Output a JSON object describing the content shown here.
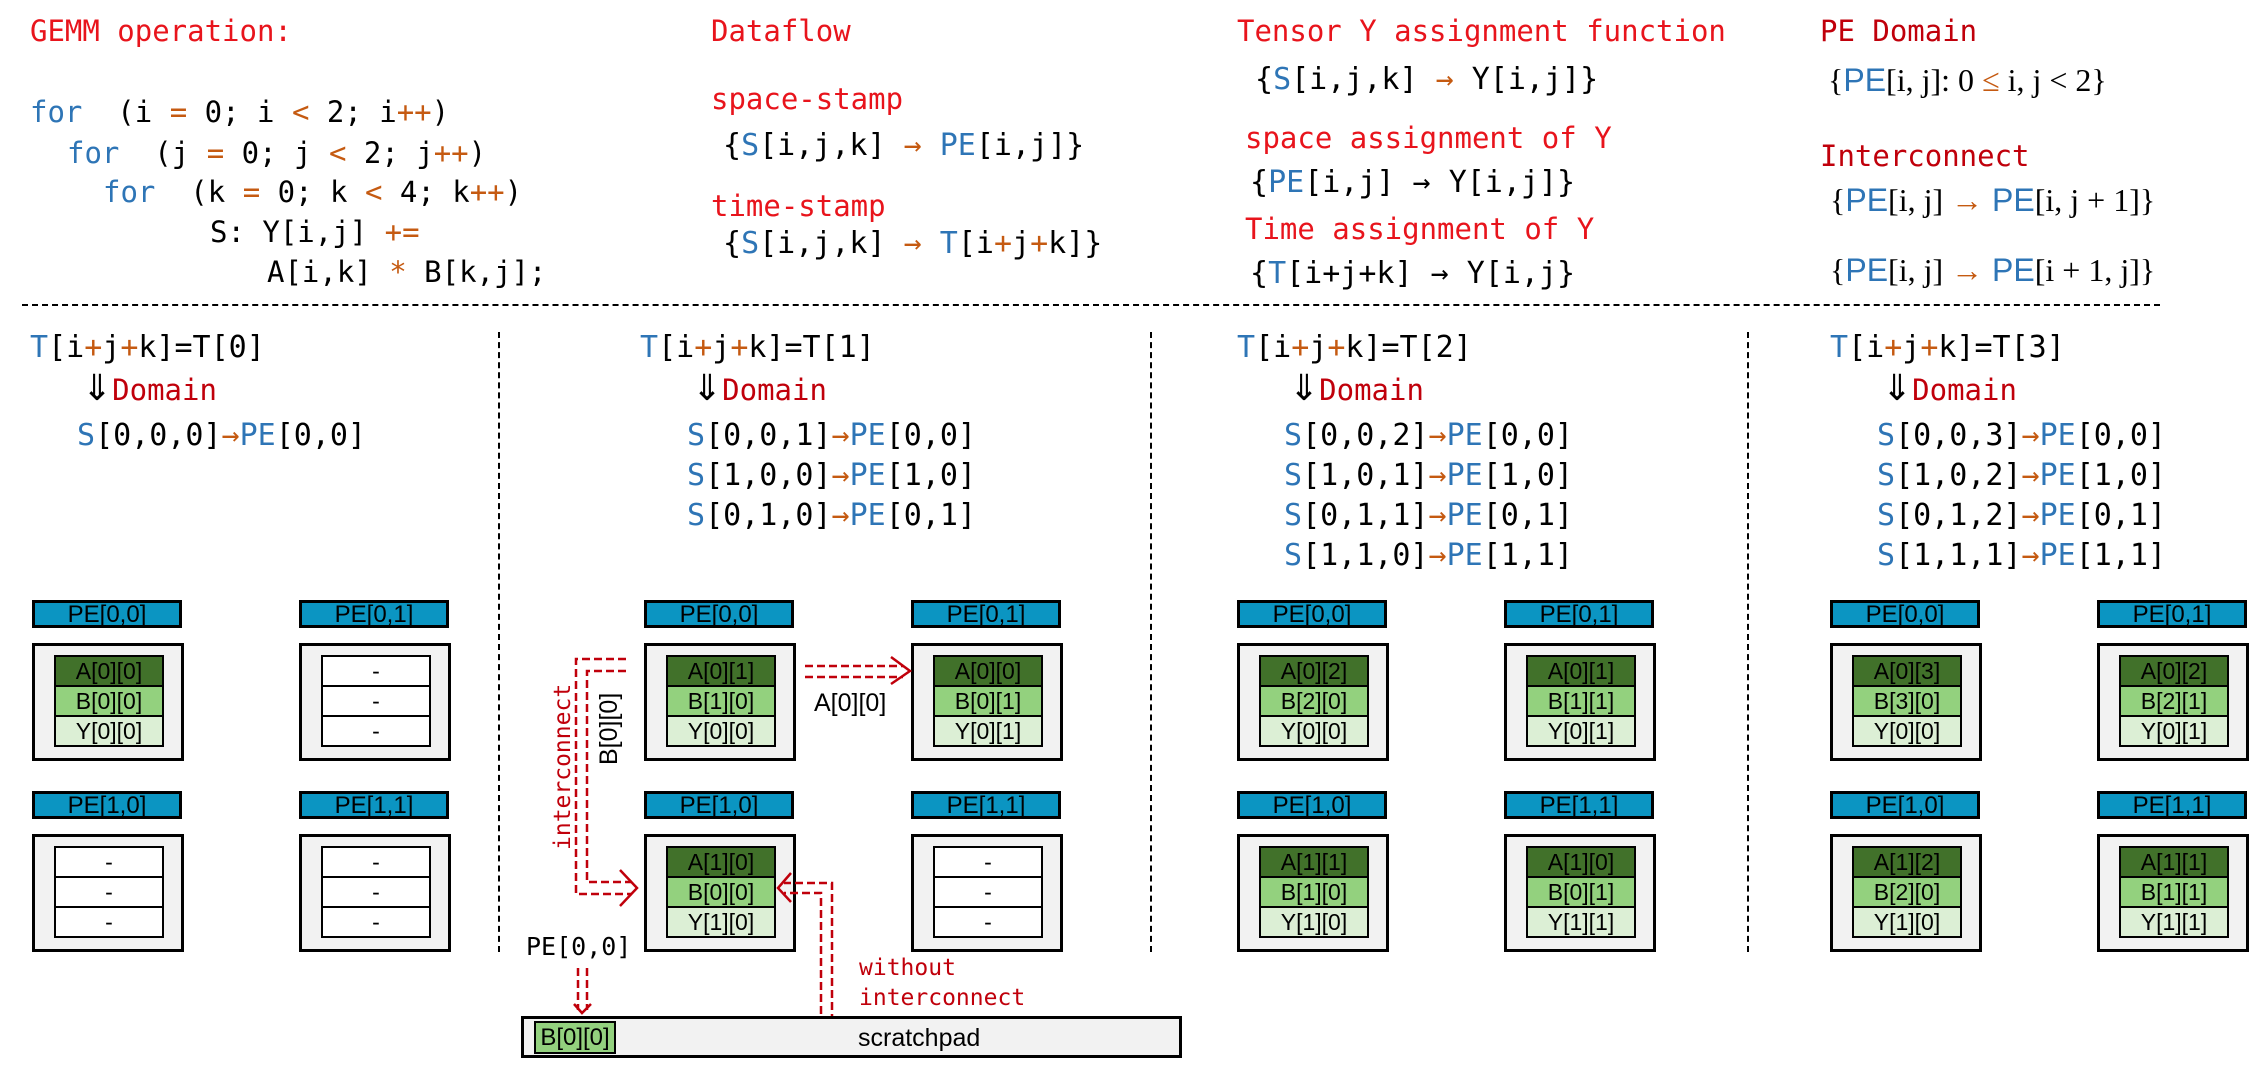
{
  "gemm": {
    "title": "GEMM operation:",
    "loop_kw": "for",
    "line1": {
      "kw": "for",
      "a": "  (i ",
      "op1": "=",
      "b": " 0; i ",
      "op2": "<",
      "c": " 2; i",
      "op3": "++",
      "d": ")"
    },
    "line2": {
      "kw": "for",
      "a": "  (j ",
      "op1": "=",
      "b": " 0; j ",
      "op2": "<",
      "c": " 2; j",
      "op3": "++",
      "d": ")"
    },
    "line3": {
      "kw": "for",
      "a": "  (k ",
      "op1": "=",
      "b": " 0; k ",
      "op2": "<",
      "c": " 4; k",
      "op3": "++",
      "d": ")"
    },
    "line4": {
      "a": "S: Y[i,j] ",
      "op": "+="
    },
    "line5": {
      "a": "A[i,k] ",
      "op": "*",
      "b": " B[k,j];"
    }
  },
  "dataflow": {
    "title": "Dataflow",
    "space_title": "space-stamp",
    "space_expr": {
      "open": "{",
      "s": "S",
      "lhs": "[i,j,k]",
      "arrow": " → ",
      "pe": "PE",
      "rhs": "[i,j]}"
    },
    "time_title": "time-stamp",
    "time_expr": {
      "open": "{",
      "s": "S",
      "lhs": "[i,j,k]",
      "arrow": " → ",
      "t": "T",
      "b1": "[i",
      "p1": "+",
      "j": "j",
      "p2": "+",
      "rhs": "k]}"
    }
  },
  "tensor_y": {
    "title": "Tensor Y assignment function",
    "expr": {
      "open": "{",
      "s": "S",
      "lhs": "[i,j,k]",
      "arrow": " → ",
      "rhs": "Y[i,j]}"
    },
    "space_title": "space assignment of Y",
    "space_expr": {
      "open": "{",
      "pe": "PE",
      "lhs": "[i,j]",
      "arrow": " → ",
      "rhs": "Y[i,j]}"
    },
    "time_title": "Time assignment of Y",
    "time_expr": {
      "open": "{",
      "t": "T",
      "lhs": "[i+j+k]",
      "arrow": " → ",
      "rhs": "Y[i,j}"
    }
  },
  "pe_domain": {
    "title": "PE Domain",
    "expr": {
      "open": "{",
      "pe": "PE",
      "a": "[i, j]: 0 ",
      "le": "≤",
      "b": " i, j < 2}"
    },
    "interconnect_title": "Interconnect",
    "ic1": {
      "open": "{",
      "pe": "PE",
      "a": "[i, j] ",
      "arrow": "→",
      "pe2": " PE",
      "b": "[i, j + 1]}"
    },
    "ic2": {
      "open": "{",
      "pe": "PE",
      "a": "[i, j] ",
      "arrow": "→",
      "pe2": " PE",
      "b": "[i + 1, j]}"
    }
  },
  "colors": {
    "title_red": "#e8141c",
    "dark_red": "#c0000b",
    "blue": "#2e75b6",
    "orange": "#c55a11",
    "pe_header": "#0b95c2",
    "reg_A": "#41712a",
    "reg_B": "#93d17e",
    "reg_Y": "#dcefd5",
    "pe_box": "#f2f2f2"
  },
  "steps": [
    {
      "t_label": {
        "t": "T",
        "a": "[i",
        "p1": "+",
        "b": "j",
        "p2": "+",
        "c": "k]=T[0]"
      },
      "domain_label": "Domain",
      "mappings": [
        {
          "s": "S",
          "idx": "[0,0,0]",
          "arrow": "→",
          "pe": "PE",
          "pidx": "[0,0]"
        }
      ],
      "pes": [
        {
          "name": "PE[0,0]",
          "regs": [
            "A[0][0]",
            "B[0][0]",
            "Y[0][0]"
          ]
        },
        {
          "name": "PE[0,1]",
          "regs": [
            "-",
            "-",
            "-"
          ]
        },
        {
          "name": "PE[1,0]",
          "regs": [
            "-",
            "-",
            "-"
          ]
        },
        {
          "name": "PE[1,1]",
          "regs": [
            "-",
            "-",
            "-"
          ]
        }
      ]
    },
    {
      "t_label": {
        "t": "T",
        "a": "[i",
        "p1": "+",
        "b": "j",
        "p2": "+",
        "c": "k]=T[1]"
      },
      "domain_label": "Domain",
      "mappings": [
        {
          "s": "S",
          "idx": "[0,0,1]",
          "arrow": "→",
          "pe": "PE",
          "pidx": "[0,0]"
        },
        {
          "s": "S",
          "idx": "[1,0,0]",
          "arrow": "→",
          "pe": "PE",
          "pidx": "[1,0]"
        },
        {
          "s": "S",
          "idx": "[0,1,0]",
          "arrow": "→",
          "pe": "PE",
          "pidx": "[0,1]"
        }
      ],
      "pes": [
        {
          "name": "PE[0,0]",
          "regs": [
            "A[0][1]",
            "B[1][0]",
            "Y[0][0]"
          ]
        },
        {
          "name": "PE[0,1]",
          "regs": [
            "A[0][0]",
            "B[0][1]",
            "Y[0][1]"
          ]
        },
        {
          "name": "PE[1,0]",
          "regs": [
            "A[1][0]",
            "B[0][0]",
            "Y[1][0]"
          ]
        },
        {
          "name": "PE[1,1]",
          "regs": [
            "-",
            "-",
            "-"
          ]
        }
      ],
      "annotations": {
        "a_transfer": "A[0][0]",
        "b_transfer": "B[0][0]",
        "interconnect": "interconnect",
        "pe_source": "PE[0,0]",
        "without_1": "without",
        "without_2": "interconnect",
        "scratchpad_label": "scratchpad",
        "scratchpad_item": "B[0][0]"
      }
    },
    {
      "t_label": {
        "t": "T",
        "a": "[i",
        "p1": "+",
        "b": "j",
        "p2": "+",
        "c": "k]=T[2]"
      },
      "domain_label": "Domain",
      "mappings": [
        {
          "s": "S",
          "idx": "[0,0,2]",
          "arrow": "→",
          "pe": "PE",
          "pidx": "[0,0]"
        },
        {
          "s": "S",
          "idx": "[1,0,1]",
          "arrow": "→",
          "pe": "PE",
          "pidx": "[1,0]"
        },
        {
          "s": "S",
          "idx": "[0,1,1]",
          "arrow": "→",
          "pe": "PE",
          "pidx": "[0,1]"
        },
        {
          "s": "S",
          "idx": "[1,1,0]",
          "arrow": "→",
          "pe": "PE",
          "pidx": "[1,1]"
        }
      ],
      "pes": [
        {
          "name": "PE[0,0]",
          "regs": [
            "A[0][2]",
            "B[2][0]",
            "Y[0][0]"
          ]
        },
        {
          "name": "PE[0,1]",
          "regs": [
            "A[0][1]",
            "B[1][1]",
            "Y[0][1]"
          ]
        },
        {
          "name": "PE[1,0]",
          "regs": [
            "A[1][1]",
            "B[1][0]",
            "Y[1][0]"
          ]
        },
        {
          "name": "PE[1,1]",
          "regs": [
            "A[1][0]",
            "B[0][1]",
            "Y[1][1]"
          ]
        }
      ]
    },
    {
      "t_label": {
        "t": "T",
        "a": "[i",
        "p1": "+",
        "b": "j",
        "p2": "+",
        "c": "k]=T[3]"
      },
      "domain_label": "Domain",
      "mappings": [
        {
          "s": "S",
          "idx": "[0,0,3]",
          "arrow": "→",
          "pe": "PE",
          "pidx": "[0,0]"
        },
        {
          "s": "S",
          "idx": "[1,0,2]",
          "arrow": "→",
          "pe": "PE",
          "pidx": "[1,0]"
        },
        {
          "s": "S",
          "idx": "[0,1,2]",
          "arrow": "→",
          "pe": "PE",
          "pidx": "[0,1]"
        },
        {
          "s": "S",
          "idx": "[1,1,1]",
          "arrow": "→",
          "pe": "PE",
          "pidx": "[1,1]"
        }
      ],
      "pes": [
        {
          "name": "PE[0,0]",
          "regs": [
            "A[0][3]",
            "B[3][0]",
            "Y[0][0]"
          ]
        },
        {
          "name": "PE[0,1]",
          "regs": [
            "A[0][2]",
            "B[2][1]",
            "Y[0][1]"
          ]
        },
        {
          "name": "PE[1,0]",
          "regs": [
            "A[1][2]",
            "B[2][0]",
            "Y[1][0]"
          ]
        },
        {
          "name": "PE[1,1]",
          "regs": [
            "A[1][1]",
            "B[1][1]",
            "Y[1][1]"
          ]
        }
      ]
    }
  ]
}
